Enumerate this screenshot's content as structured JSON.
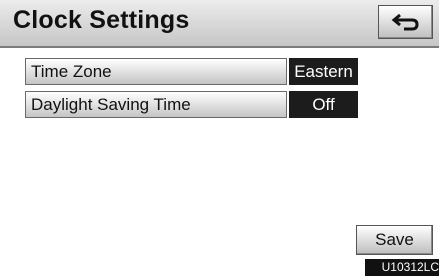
{
  "header": {
    "title": "Clock Settings",
    "back_icon": "return-arrow-icon"
  },
  "settings": [
    {
      "label": "Time Zone",
      "value": "Eastern"
    },
    {
      "label": "Daylight Saving Time",
      "value": "Off"
    }
  ],
  "footer": {
    "save_label": "Save",
    "figure_code": "U10312LC"
  }
}
